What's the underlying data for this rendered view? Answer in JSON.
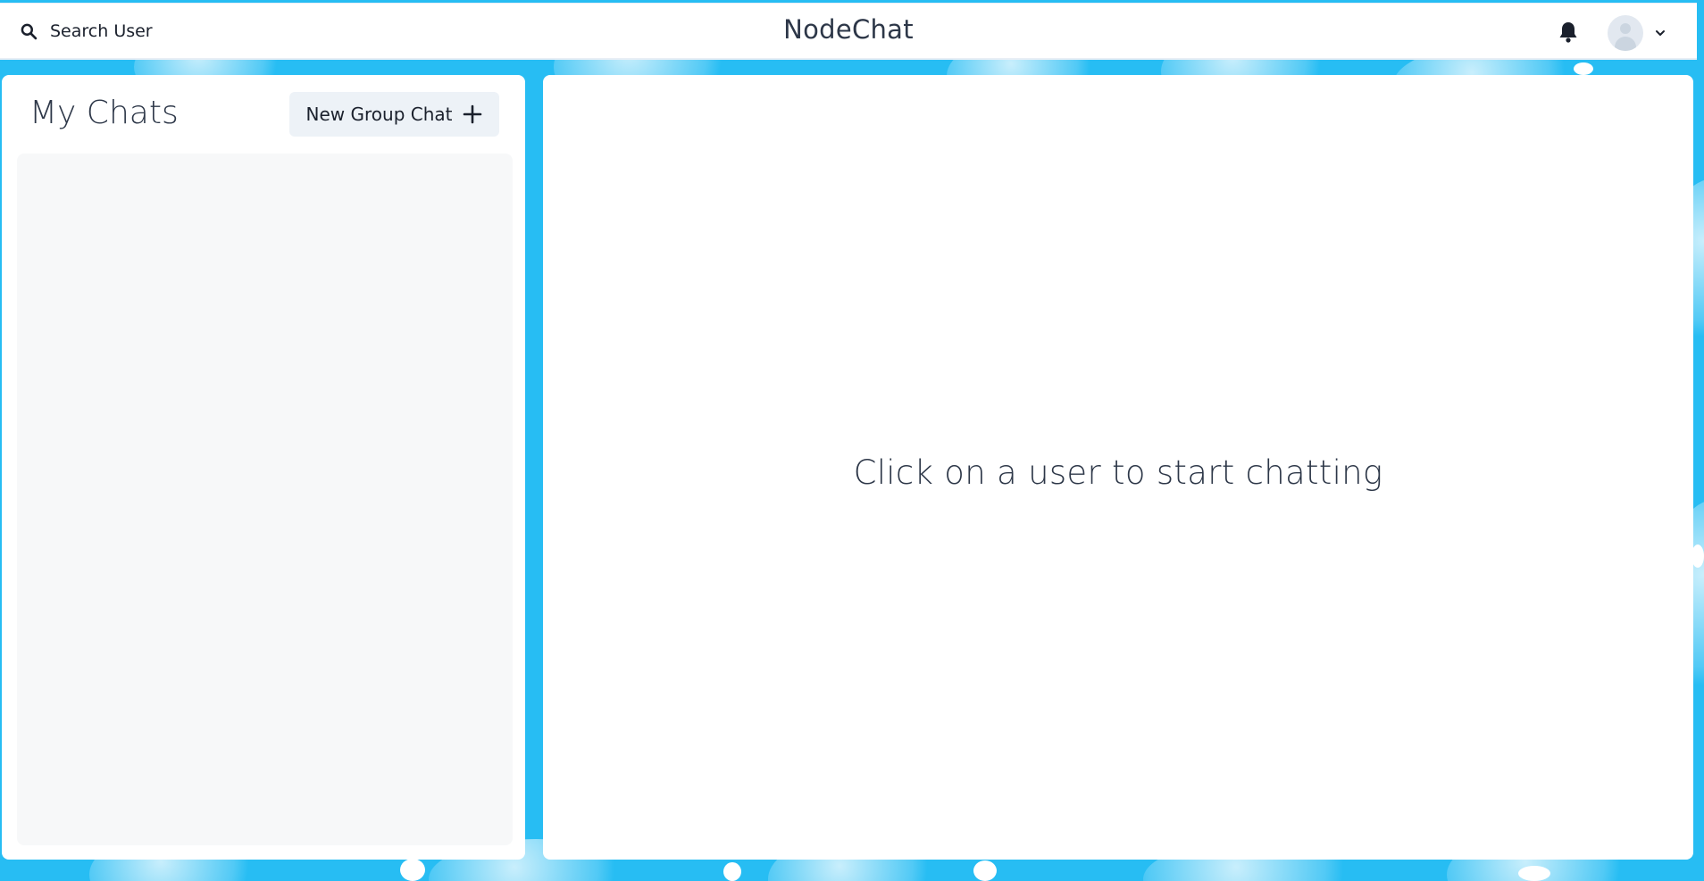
{
  "header": {
    "search_label": "Search User",
    "brand": "NodeChat",
    "search_icon": "search-icon",
    "notification_icon": "bell-icon",
    "profile_menu_icon": "chevron-down-icon"
  },
  "sidebar": {
    "title": "My Chats",
    "new_group_label": "New Group Chat",
    "new_group_icon": "plus-icon",
    "chats": []
  },
  "main": {
    "empty_message": "Click on a user to start chatting"
  },
  "colors": {
    "background": "#27bdf3",
    "panel": "#ffffff",
    "chat_list_bg": "#f7f8f9",
    "button_bg": "#edf2f7",
    "text": "#2d3748"
  }
}
